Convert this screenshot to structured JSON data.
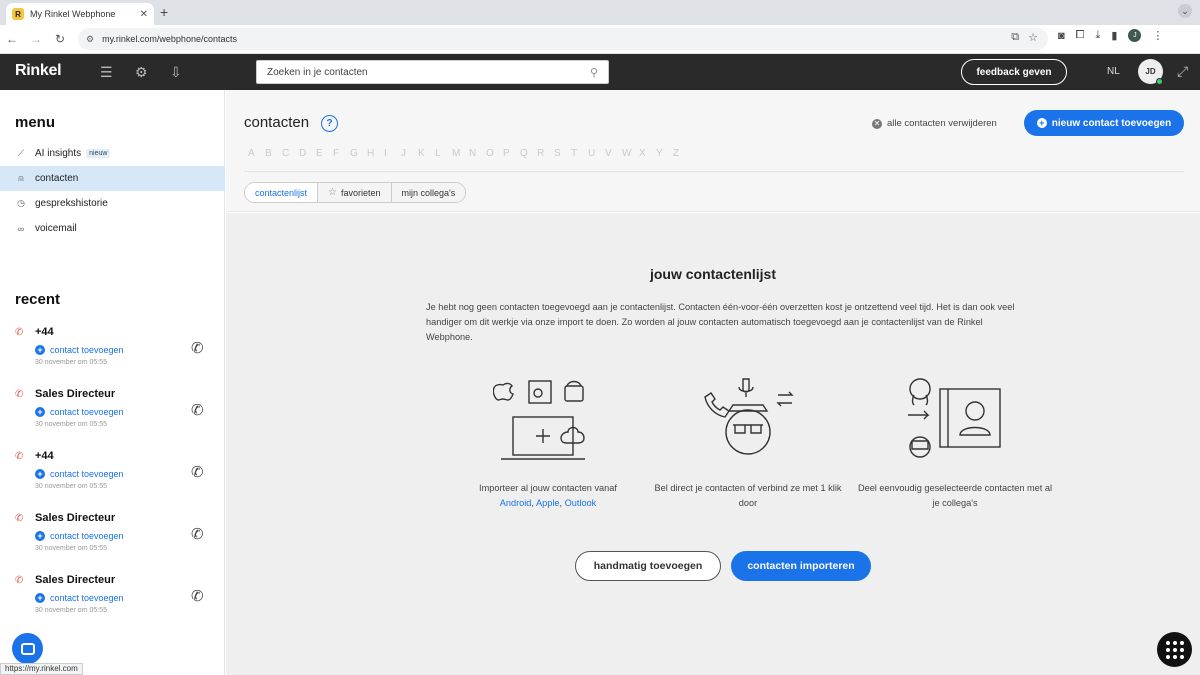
{
  "browser": {
    "tab_title": "My Rinkel Webphone",
    "favicon_letter": "R",
    "url": "my.rinkel.com/webphone/contacts",
    "profile_initial": "J",
    "status_url": "https://my.rinkel.com"
  },
  "header": {
    "logo": "Rinkel",
    "search_placeholder": "Zoeken in je contacten",
    "feedback_label": "feedback geven",
    "language": "NL",
    "avatar_initials": "JD"
  },
  "sidebar": {
    "menu_heading": "menu",
    "menu_items": [
      {
        "label": "AI insights",
        "badge": "nieuw",
        "icon": "chart-icon"
      },
      {
        "label": "contacten",
        "icon": "person-icon"
      },
      {
        "label": "gesprekshistorie",
        "icon": "clock-icon"
      },
      {
        "label": "voicemail",
        "icon": "voicemail-icon"
      }
    ],
    "recent_heading": "recent",
    "recent": [
      {
        "name": "+44",
        "action": "contact toevoegen",
        "time": "30 november om 05:55"
      },
      {
        "name": "Sales Directeur",
        "action": "contact toevoegen",
        "time": "30 november om 05:55"
      },
      {
        "name": "+44",
        "action": "contact toevoegen",
        "time": "30 november om 05:55"
      },
      {
        "name": "Sales Directeur",
        "action": "contact toevoegen",
        "time": "30 november om 05:55"
      },
      {
        "name": "Sales Directeur",
        "action": "contact toevoegen",
        "time": "30 november om 05:55"
      }
    ]
  },
  "main": {
    "title": "contacten",
    "delete_all": "alle contacten verwijderen",
    "new_contact": "nieuw contact toevoegen",
    "alphabet": [
      "A",
      "B",
      "C",
      "D",
      "E",
      "F",
      "G",
      "H",
      "I",
      "J",
      "K",
      "L",
      "M",
      "N",
      "O",
      "P",
      "Q",
      "R",
      "S",
      "T",
      "U",
      "V",
      "W",
      "X",
      "Y",
      "Z"
    ],
    "tabs": [
      "contactenlijst",
      "favorieten",
      "mijn collega's"
    ],
    "empty": {
      "title": "jouw contactenlijst",
      "description": "Je hebt nog geen contacten toegevoegd aan je contactenlijst. Contacten één-voor-één overzetten kost je ontzettend veel tijd. Het is dan ook veel handiger om dit werkje via onze import te doen. Zo worden al jouw contacten automatisch toegevoegd aan je contactenlijst van de Rinkel Webphone.",
      "feature1_text": "Importeer al jouw contacten vanaf",
      "feature1_links": [
        "Android",
        "Apple",
        "Outlook"
      ],
      "feature1_sep": ", ",
      "feature2_text": "Bel direct je contacten of verbind ze met 1 klik door",
      "feature3_text": "Deel eenvoudig geselecteerde contacten met al je collega's",
      "manual_button": "handmatig toevoegen",
      "import_button": "contacten importeren"
    }
  },
  "colors": {
    "accent": "#1a73e8",
    "header_bg": "#2a2a2a",
    "active_menu_bg": "#d6e8f8",
    "missed_call": "#e25a4c"
  }
}
